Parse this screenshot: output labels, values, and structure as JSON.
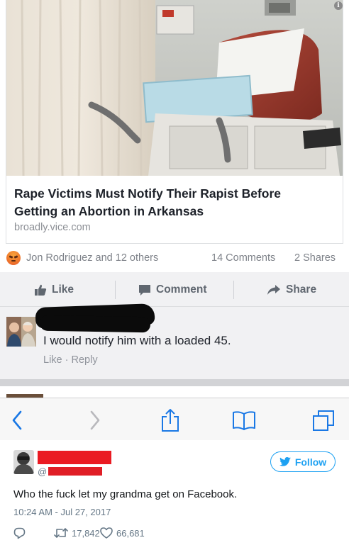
{
  "link_card": {
    "title": "Rape Victims Must Notify Their Rapist Before Getting an Abortion in Arkansas",
    "domain": "broadly.vice.com",
    "info_icon": "i"
  },
  "reactions": {
    "reaction_icon": "angry-reaction-icon",
    "names": "Jon Rodriguez and 12 others",
    "comments": "14 Comments",
    "shares": "2 Shares"
  },
  "actions": {
    "like": "Like",
    "comment": "Comment",
    "share": "Share"
  },
  "comment": {
    "text": "I would notify him with a loaded 45.",
    "like": "Like",
    "separator": " · ",
    "reply": "Reply"
  },
  "browser_toolbar": {
    "buttons": [
      "back-icon",
      "forward-icon",
      "share-icon",
      "bookmarks-icon",
      "tabs-icon"
    ]
  },
  "tweet": {
    "handle_prefix": "@",
    "follow_label": "Follow",
    "text": "Who the fuck let my grandma get on Facebook.",
    "timestamp": "10:24 AM - Jul 27, 2017",
    "retweets": "17,842",
    "likes": "66,681"
  },
  "colors": {
    "facebook_gray": "#606770",
    "twitter_blue": "#1da1f2",
    "redaction_red": "#ea1a22",
    "redaction_black": "#0b0b0b"
  }
}
